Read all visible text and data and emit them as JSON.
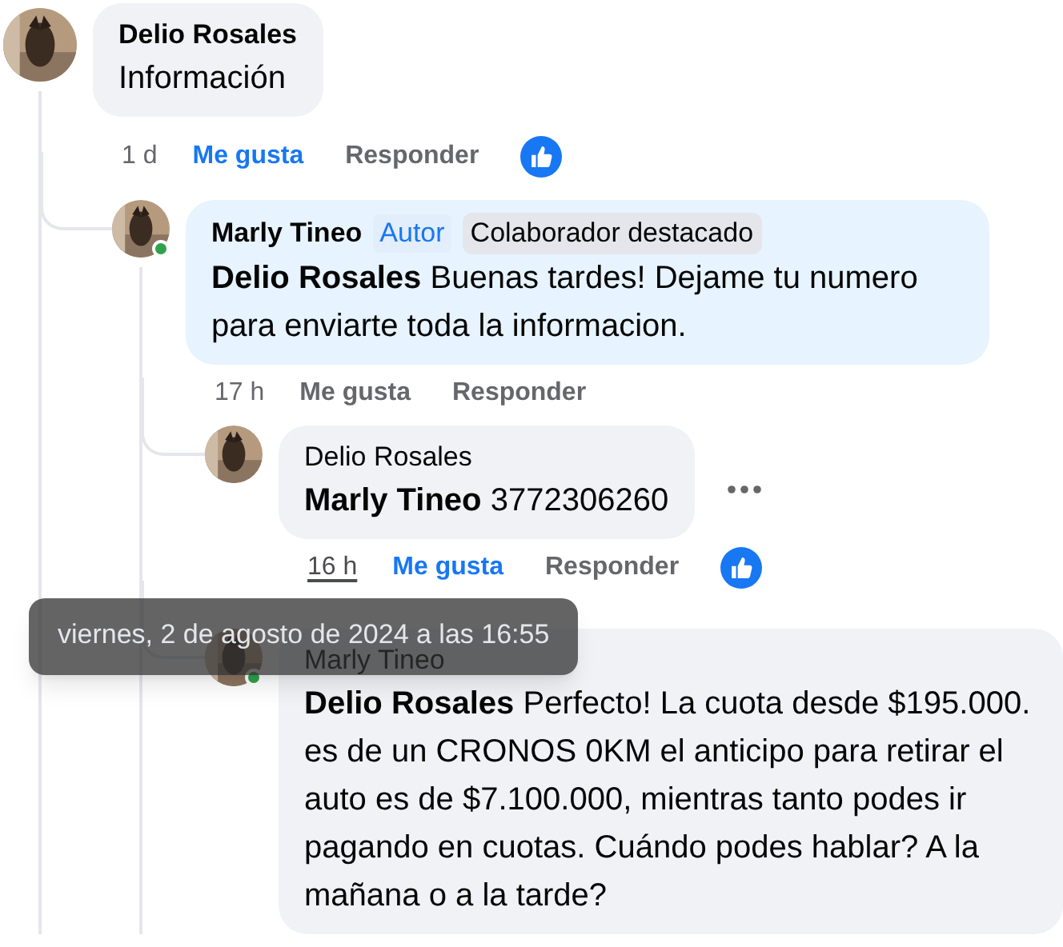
{
  "comments": [
    {
      "author": "Delio Rosales",
      "online": false,
      "text": "Información",
      "time": "1 d",
      "time_hovered": false,
      "liked": true,
      "like": "Me gusta",
      "reply": "Responder",
      "reaction": true,
      "children": [
        {
          "author": "Marly Tineo",
          "online": true,
          "badges": [
            {
              "label": "Autor",
              "kind": "role"
            },
            {
              "label": "Colaborador destacado",
              "kind": "chip"
            }
          ],
          "text": "**Delio Rosales** Buenas tardes! Dejame tu numero para enviarte toda la informacion.",
          "time": "17 h",
          "time_hovered": false,
          "liked": false,
          "like": "Me gusta",
          "reply": "Responder",
          "reaction": false,
          "children": [
            {
              "author": "Delio Rosales",
              "online": false,
              "text": "**Marly Tineo** 3772306260",
              "time": "16 h",
              "time_hovered": true,
              "liked": true,
              "like": "Me gusta",
              "reply": "Responder",
              "reaction": true,
              "more_options": true
            },
            {
              "author": "Marly Tineo",
              "online": true,
              "text": "**Delio Rosales** Perfecto! La cuota desde $195.000. es de un CRONOS 0KM el anticipo para retirar el auto es de $7.100.000, mientras tanto podes ir pagando en cuotas. Cuándo podes hablar? A la mañana o a la tarde?"
            }
          ]
        }
      ]
    }
  ],
  "tooltip": {
    "text": "viernes, 2 de agosto de 2024 a las 16:55"
  }
}
